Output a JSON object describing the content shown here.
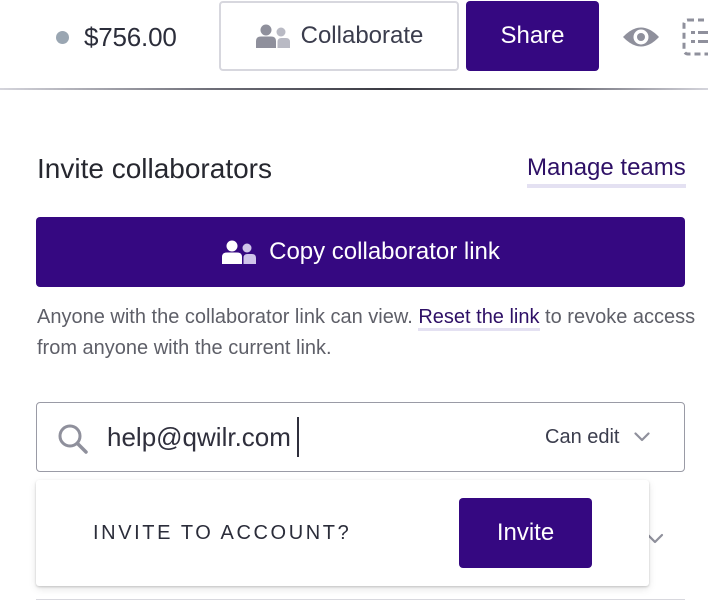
{
  "header": {
    "price": "$756.00",
    "collaborate_label": "Collaborate",
    "share_label": "Share",
    "preview_icon": "eye-icon",
    "outline_icon": "list-icon"
  },
  "panel": {
    "title": "Invite collaborators",
    "manage_teams_label": "Manage teams",
    "copy_link_label": "Copy collaborator link",
    "help_text_before": "Anyone with the collaborator link can view. ",
    "reset_link_label": "Reset the link",
    "help_text_after": " to revoke access from anyone with the current link."
  },
  "invite_field": {
    "value": "help@qwilr.com",
    "permission_label": "Can edit"
  },
  "invite_popover": {
    "label": "INVITE TO ACCOUNT?",
    "button_label": "Invite"
  },
  "colors": {
    "primary": "#350881",
    "link": "#2e1066",
    "link_underline": "#e4e1f2",
    "status_dot": "#9aa6b2"
  }
}
